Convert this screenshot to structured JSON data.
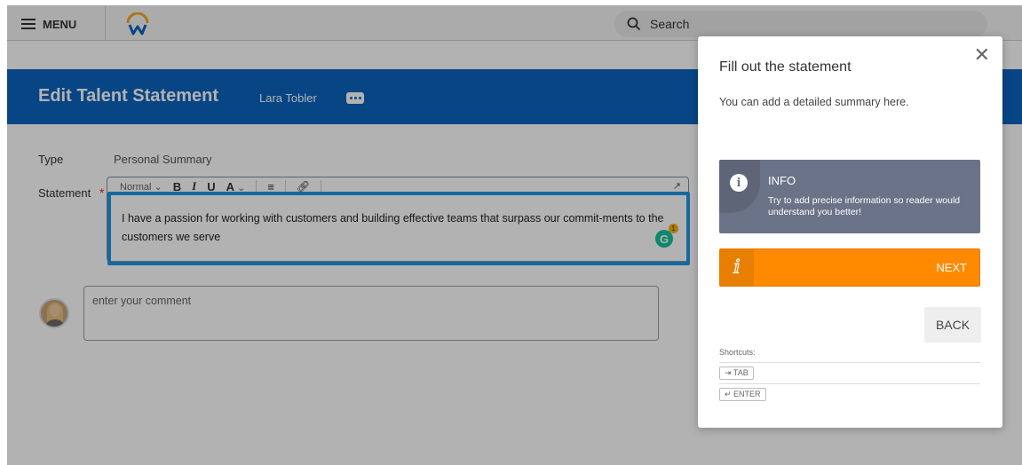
{
  "topbar": {
    "menu_label": "MENU",
    "search_label": "Search"
  },
  "header": {
    "title": "Edit Talent Statement",
    "subtitle": "Lara Tobler"
  },
  "form": {
    "type_label": "Type",
    "type_value": "Personal Summary",
    "statement_label": "Statement",
    "required_marker": "*",
    "toolbar": {
      "style_select": "Normal",
      "bold": "B",
      "italic": "I",
      "underline": "U",
      "font_color": "A"
    },
    "statement_text": "I have a passion for working with customers and building effective teams that surpass our commit-ments to the customers we serve",
    "grammarly_letter": "G",
    "grammarly_count": "1",
    "comment_placeholder": "enter your comment"
  },
  "guide_panel": {
    "title": "Fill out the statement",
    "description": "You can add a detailed summary here.",
    "info": {
      "title": "INFO",
      "text": "Try to add precise information so reader would understand you better!"
    },
    "next_label": "NEXT",
    "back_label": "BACK",
    "shortcuts_label": "Shortcuts:",
    "shortcuts": [
      "⇥ TAB",
      "↵ ENTER"
    ]
  },
  "colors": {
    "header_blue": "#0b64be",
    "focus_blue": "#1d98e4",
    "next_orange": "#ff8a00",
    "info_gray": "#6a7387",
    "required_red": "#d9261c"
  }
}
